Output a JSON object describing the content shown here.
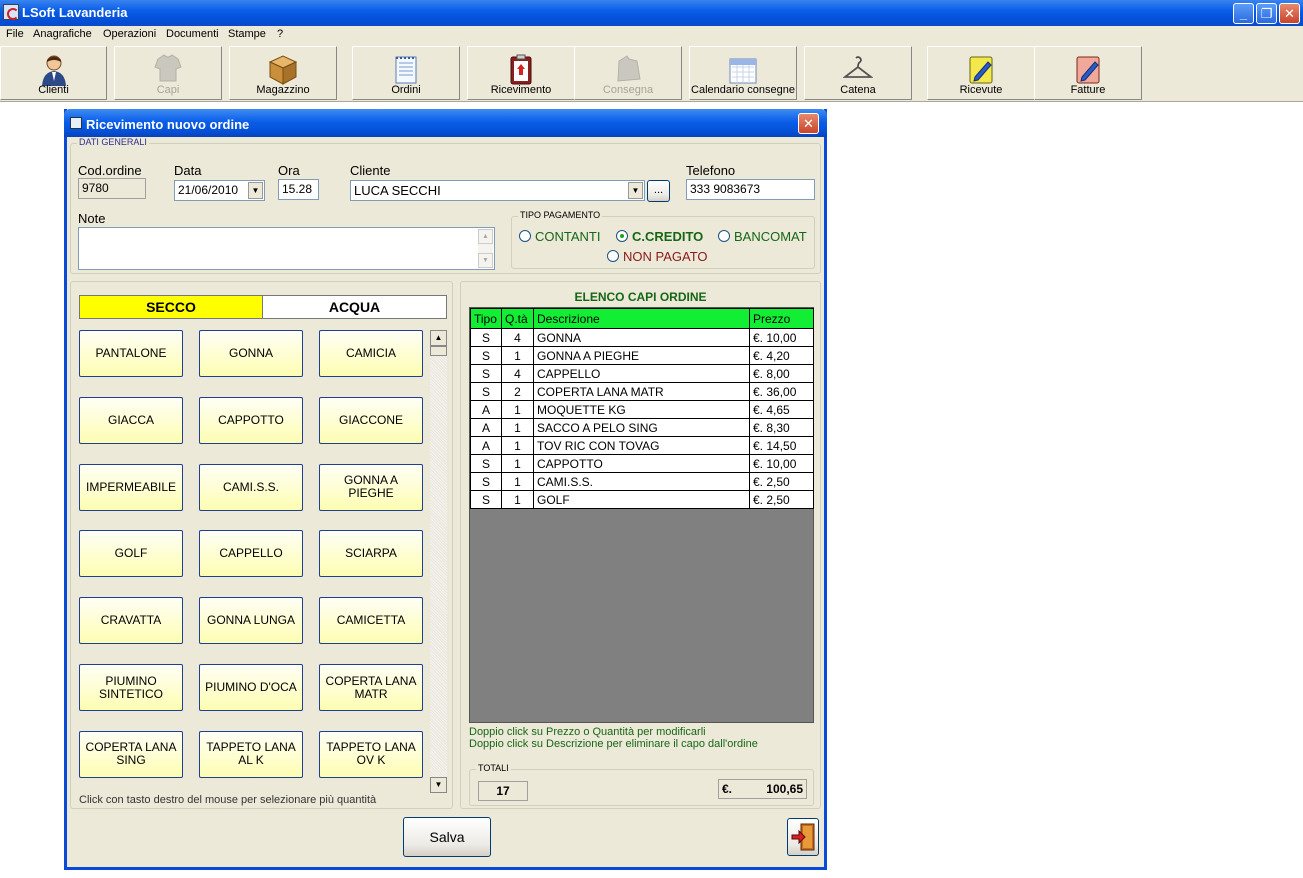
{
  "window": {
    "title": "LSoft Lavanderia",
    "controls": {
      "minimize": "_",
      "restore": "❐",
      "close": "✕"
    }
  },
  "menu": [
    "File",
    "Anagrafiche",
    "Operazioni",
    "Documenti",
    "Stampe",
    "?"
  ],
  "toolbar": [
    {
      "label": "Clienti",
      "icon": "user-icon",
      "enabled": true
    },
    {
      "label": "Capi",
      "icon": "shirt-icon",
      "enabled": false
    },
    {
      "label": "Magazzino",
      "icon": "box-icon",
      "enabled": true
    },
    {
      "label": "Ordini",
      "icon": "notepad-icon",
      "enabled": true
    },
    {
      "label": "Ricevimento",
      "icon": "clipboard-icon",
      "enabled": true
    },
    {
      "label": "Consegna",
      "icon": "delivery-icon",
      "enabled": false
    },
    {
      "label": "Calendario consegne",
      "icon": "calendar-icon",
      "enabled": true
    },
    {
      "label": "Catena",
      "icon": "hanger-icon",
      "enabled": true
    },
    {
      "label": "Ricevute",
      "icon": "receipt-icon",
      "enabled": true
    },
    {
      "label": "Fatture",
      "icon": "invoice-icon",
      "enabled": true
    }
  ],
  "dialog": {
    "title": "Ricevimento nuovo ordine",
    "close": "✕",
    "dati_generali": {
      "caption": "DATI GENERALI",
      "cod_ordine": {
        "label": "Cod.ordine",
        "value": "9780"
      },
      "data": {
        "label": "Data",
        "value": "21/06/2010"
      },
      "ora": {
        "label": "Ora",
        "value": "15.28"
      },
      "cliente": {
        "label": "Cliente",
        "value": "LUCA SECCHI",
        "browse": "..."
      },
      "telefono": {
        "label": "Telefono",
        "value": "333 9083673"
      },
      "note": {
        "label": "Note",
        "value": ""
      }
    },
    "tipo_pagamento": {
      "caption": "TIPO PAGAMENTO",
      "options": [
        {
          "label": "CONTANTI",
          "selected": false
        },
        {
          "label": "C.CREDITO",
          "selected": true
        },
        {
          "label": "BANCOMAT",
          "selected": false
        },
        {
          "label": "NON PAGATO",
          "selected": false
        }
      ]
    },
    "tabs": [
      {
        "label": "SECCO",
        "active": true
      },
      {
        "label": "ACQUA",
        "active": false
      }
    ],
    "garments": [
      "PANTALONE",
      "GONNA",
      "CAMICIA",
      "GIACCA",
      "CAPPOTTO",
      "GIACCONE",
      "IMPERMEABILE",
      "CAMI.S.S.",
      "GONNA A PIEGHE",
      "GOLF",
      "CAPPELLO",
      "SCIARPA",
      "CRAVATTA",
      "GONNA LUNGA",
      "CAMICETTA",
      "PIUMINO SINTETICO",
      "PIUMINO D'OCA",
      "COPERTA LANA MATR",
      "COPERTA LANA SING",
      "TAPPETO LANA AL K",
      "TAPPETO LANA OV K"
    ],
    "garments_hint": "Click con tasto destro del mouse per selezionare più quantità",
    "order_list": {
      "title": "ELENCO CAPI ORDINE",
      "columns": [
        "Tipo",
        "Q.tà",
        "Descrizione",
        "Prezzo"
      ],
      "rows": [
        [
          "S",
          "4",
          "GONNA",
          "€. 10,00"
        ],
        [
          "S",
          "1",
          "GONNA A PIEGHE",
          "€. 4,20"
        ],
        [
          "S",
          "4",
          "CAPPELLO",
          "€. 8,00"
        ],
        [
          "S",
          "2",
          "COPERTA LANA MATR",
          "€. 36,00"
        ],
        [
          "A",
          "1",
          "MOQUETTE KG",
          "€. 4,65"
        ],
        [
          "A",
          "1",
          "SACCO A PELO SING",
          "€. 8,30"
        ],
        [
          "A",
          "1",
          "TOV RIC CON TOVAG",
          "€. 14,50"
        ],
        [
          "S",
          "1",
          "CAPPOTTO",
          "€. 10,00"
        ],
        [
          "S",
          "1",
          "CAMI.S.S.",
          "€. 2,50"
        ],
        [
          "S",
          "1",
          "GOLF",
          "€. 2,50"
        ]
      ],
      "hint1": "Doppio click su Prezzo o Quantità per modificarli",
      "hint2": "Doppio click su Descrizione per eliminare il capo dall'ordine"
    },
    "totali": {
      "caption": "TOTALI",
      "quantity": "17",
      "currency": "€.",
      "amount": "100,65"
    },
    "save_label": "Salva"
  }
}
